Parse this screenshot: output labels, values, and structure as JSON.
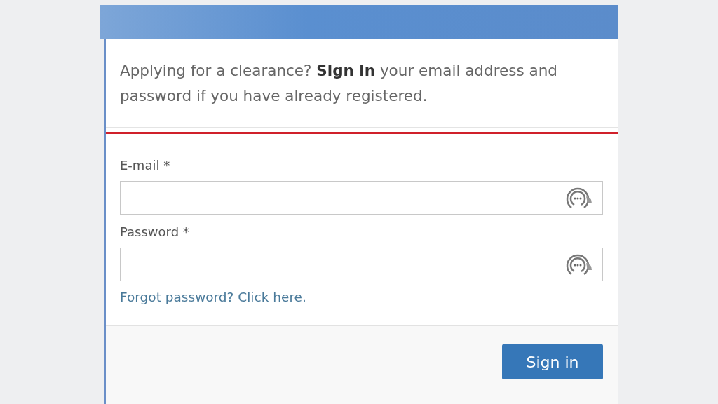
{
  "intro": "Applying for a clearance? **Sign in** your email address and password if you have already registered.",
  "fields": [
    {
      "label": "E-mail *"
    },
    {
      "label": "Password *"
    }
  ],
  "forgot_link": "Forgot password? Click here.",
  "submit_button": "Sign in"
}
